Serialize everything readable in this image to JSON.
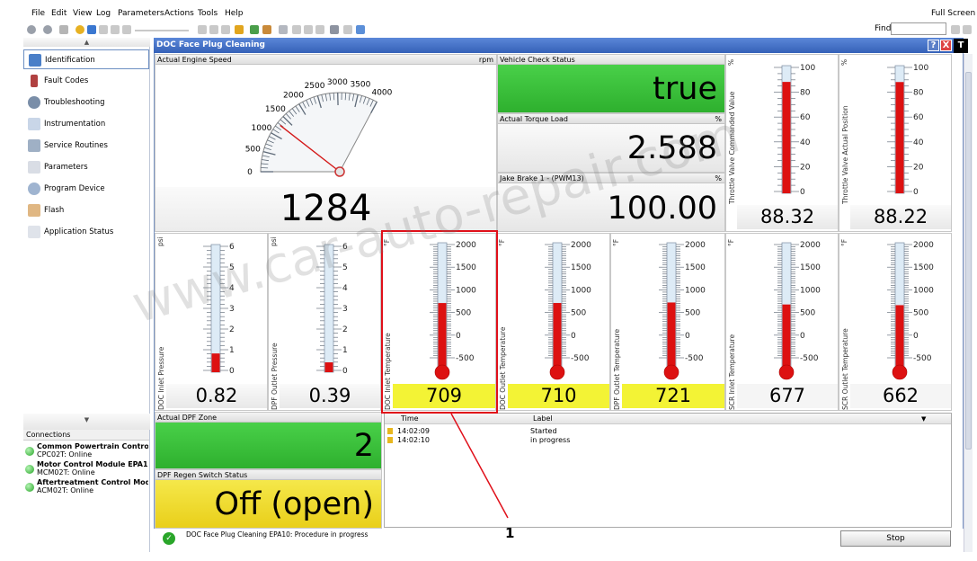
{
  "menu": {
    "items": [
      "File",
      "Edit",
      "View",
      "Log",
      "Parameters",
      "Actions",
      "Tools",
      "Help"
    ],
    "full_screen": "Full Screen"
  },
  "toolbar": {
    "find_label": "Find",
    "find_value": ""
  },
  "nav": {
    "items": [
      {
        "label": "Identification",
        "icon": "identification-icon"
      },
      {
        "label": "Fault Codes",
        "icon": "fault-codes-icon"
      },
      {
        "label": "Troubleshooting",
        "icon": "troubleshooting-icon"
      },
      {
        "label": "Instrumentation",
        "icon": "instrumentation-icon"
      },
      {
        "label": "Service Routines",
        "icon": "service-routines-icon"
      },
      {
        "label": "Parameters",
        "icon": "parameters-icon"
      },
      {
        "label": "Program Device",
        "icon": "program-device-icon"
      },
      {
        "label": "Flash",
        "icon": "flash-icon"
      },
      {
        "label": "Application Status",
        "icon": "application-status-icon"
      }
    ]
  },
  "connections": {
    "header": "Connections",
    "items": [
      {
        "name": "Common Powertrain Contro...",
        "status": "CPC02T: Online"
      },
      {
        "name": "Motor Control Module EPA10",
        "status": "MCM02T: Online"
      },
      {
        "name": "Aftertreatment Control Mod...",
        "status": "ACM02T: Online"
      }
    ]
  },
  "window": {
    "title": "DOC Face Plug Cleaning",
    "help": "?",
    "close": "X",
    "logo": "T"
  },
  "engine_speed": {
    "title": "Actual Engine Speed",
    "unit": "rpm",
    "value": "1284",
    "gauge_min": 0,
    "gauge_max": 4000,
    "ticks": [
      "0",
      "500",
      "1000",
      "1500",
      "2000",
      "2500",
      "3000",
      "3500",
      "4000"
    ]
  },
  "vehicle_check": {
    "title": "Vehicle Check Status",
    "value": "true"
  },
  "torque": {
    "title": "Actual Torque Load",
    "unit": "%",
    "value": "2.588"
  },
  "jake_brake": {
    "title": "Jake Brake 1 - (PWM13)",
    "unit": "%",
    "value": "100.00"
  },
  "throttle_cmd": {
    "title": "Throttle Valve Commanded Value",
    "unit": "%",
    "value": "88.32",
    "level": 88.32,
    "ticks": [
      "100",
      "80",
      "60",
      "40",
      "20",
      "0"
    ]
  },
  "throttle_pos": {
    "title": "Throttle Valve Actual Position",
    "unit": "%",
    "value": "88.22",
    "level": 88.22,
    "ticks": [
      "100",
      "80",
      "60",
      "40",
      "20",
      "0"
    ]
  },
  "doc_inlet_pressure": {
    "title": "DOC Inlet Pressure",
    "unit": "psi",
    "value": "0.82",
    "ticks": [
      "6",
      "5",
      "4",
      "3",
      "2",
      "1",
      "0"
    ]
  },
  "dpf_outlet_pressure": {
    "title": "DPF Outlet Pressure",
    "unit": "psi",
    "value": "0.39",
    "ticks": [
      "6",
      "5",
      "4",
      "3",
      "2",
      "1",
      "0"
    ]
  },
  "temps": [
    {
      "title": "DOC Inlet Temperature",
      "unit": "°F",
      "value": "709",
      "highlight": true
    },
    {
      "title": "DOC Outlet Temperature",
      "unit": "°F",
      "value": "710",
      "highlight": true
    },
    {
      "title": "DPF Outlet Temperature",
      "unit": "°F",
      "value": "721",
      "highlight": true
    },
    {
      "title": "SCR Inlet Temperature",
      "unit": "°F",
      "value": "677",
      "highlight": false
    },
    {
      "title": "SCR Outlet Temperature",
      "unit": "°F",
      "value": "662",
      "highlight": false
    }
  ],
  "temp_ticks": [
    "2000",
    "1500",
    "1000",
    "500",
    "0",
    "-500"
  ],
  "dpf_zone": {
    "title": "Actual DPF Zone",
    "value": "2"
  },
  "dpf_regen": {
    "title": "DPF Regen Switch Status",
    "value": "Off (open)"
  },
  "log": {
    "col_time": "Time",
    "col_label": "Label",
    "rows": [
      {
        "time": "14:02:09",
        "label": "Started"
      },
      {
        "time": "14:02:10",
        "label": "in progress"
      }
    ]
  },
  "status": {
    "text": "DOC Face Plug Cleaning EPA10: Procedure in progress",
    "stop": "Stop"
  },
  "callout": {
    "number": "1"
  },
  "watermark": "www.car-auto-repair.com",
  "colors": {
    "green": "#3cc23c",
    "yellow": "#f3ea3a",
    "red": "#dd1111",
    "titlebar": "#3d68c0"
  }
}
